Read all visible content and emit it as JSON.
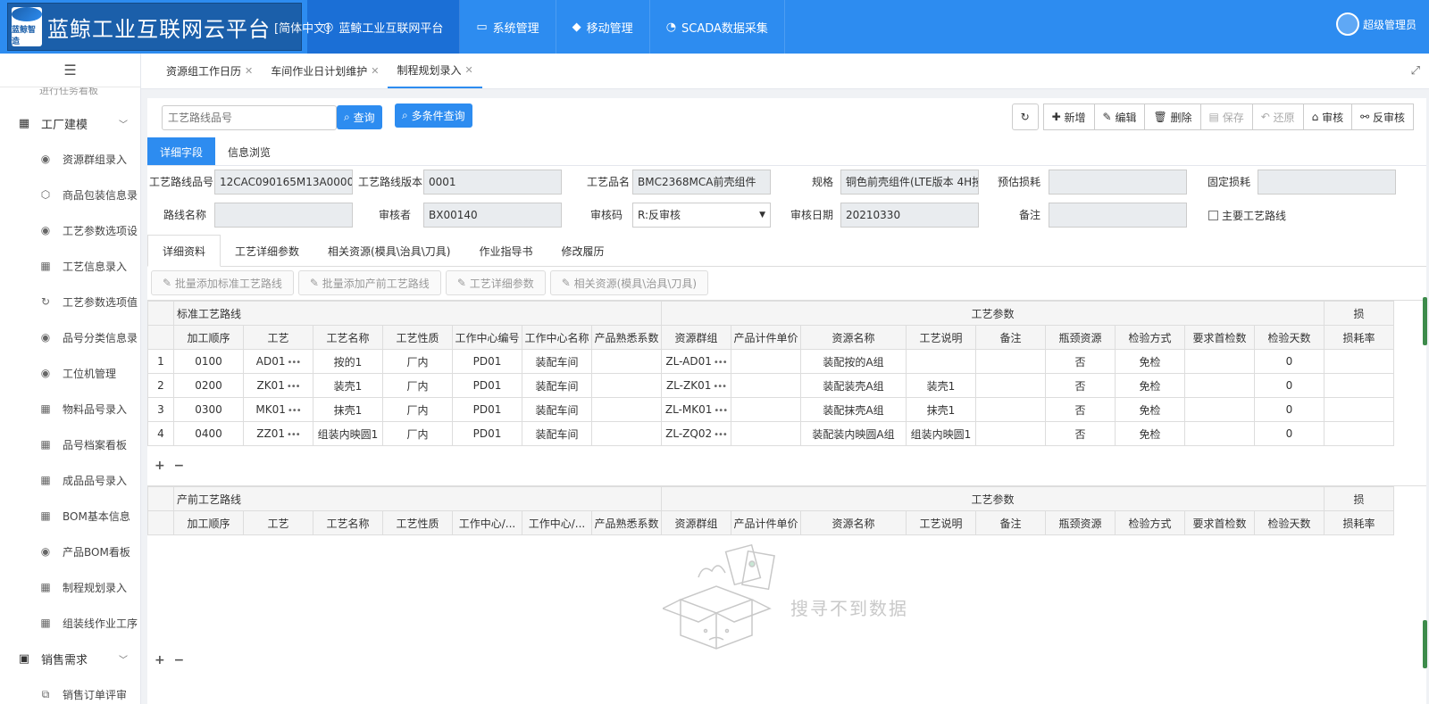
{
  "header": {
    "logo_text": "蓝鲸智造",
    "title": "蓝鲸工业互联网云平台",
    "lang": "[简体中文]",
    "nav": [
      {
        "label": "蓝鲸工业互联网平台",
        "icon": "circle-logo-icon"
      },
      {
        "label": "系统管理",
        "icon": "monitor-icon"
      },
      {
        "label": "移动管理",
        "icon": "android-icon"
      },
      {
        "label": "SCADA数据采集",
        "icon": "gauge-icon"
      }
    ],
    "user": "超级管理员"
  },
  "sidebar": {
    "cut_item": "进行任务看板",
    "group1": "工厂建模",
    "items": [
      {
        "label": "资源群组录入",
        "icon": "pin-icon"
      },
      {
        "label": "商品包装信息录",
        "icon": "package-icon"
      },
      {
        "label": "工艺参数选项设",
        "icon": "pin-icon"
      },
      {
        "label": "工艺信息录入",
        "icon": "grid-icon"
      },
      {
        "label": "工艺参数选项值",
        "icon": "refresh-icon"
      },
      {
        "label": "品号分类信息录",
        "icon": "pin-icon"
      },
      {
        "label": "工位机管理",
        "icon": "pin-icon"
      },
      {
        "label": "物料品号录入",
        "icon": "grid-icon"
      },
      {
        "label": "品号档案看板",
        "icon": "grid-icon"
      },
      {
        "label": "成品品号录入",
        "icon": "grid-icon"
      },
      {
        "label": "BOM基本信息",
        "icon": "grid-icon"
      },
      {
        "label": "产品BOM看板",
        "icon": "pin-icon"
      },
      {
        "label": "制程规划录入",
        "icon": "grid-icon"
      },
      {
        "label": "组装线作业工序",
        "icon": "grid-icon"
      }
    ],
    "group2": "销售需求",
    "item_last": "销售订单评审"
  },
  "tabs": [
    "资源组工作日历",
    "车间作业日计划维护",
    "制程规划录入"
  ],
  "toolbar": {
    "search_placeholder": "工艺路线品号",
    "query": "查询",
    "multi_query": "多条件查询",
    "add": "新增",
    "edit": "编辑",
    "delete": "删除",
    "save": "保存",
    "restore": "还原",
    "audit": "审核",
    "unaudit": "反审核"
  },
  "subtabs": [
    "详细字段",
    "信息浏览"
  ],
  "form": {
    "route_no_label": "工艺路线品号",
    "route_no": "12CAC090165M13A0000",
    "route_ver_label": "工艺路线版本",
    "route_ver": "0001",
    "product_name_label": "工艺品名",
    "product_name": "BMC2368MCA前壳组件",
    "spec_label": "规格",
    "spec": "铜色前壳组件(LTE版本 4H按",
    "est_loss_label": "预估损耗",
    "fixed_loss_label": "固定损耗",
    "route_name_label": "路线名称",
    "auditor_label": "审核者",
    "auditor": "BX00140",
    "audit_code_label": "审核码",
    "audit_code": "R:反审核",
    "audit_date_label": "审核日期",
    "audit_date": "20210330",
    "remark_label": "备注",
    "main_route_label": "主要工艺路线"
  },
  "detail_tabs": [
    "详细资料",
    "工艺详细参数",
    "相关资源(模具\\治具\\刀具)",
    "作业指导书",
    "修改履历"
  ],
  "actions": [
    "批量添加标准工艺路线",
    "批量添加产前工艺路线",
    "工艺详细参数",
    "相关资源(模具\\治具\\刀具)"
  ],
  "table1": {
    "group_left": "标准工艺路线",
    "group_right": "工艺参数",
    "group_far": "损",
    "columns": [
      "加工顺序",
      "工艺",
      "工艺名称",
      "工艺性质",
      "工作中心编号",
      "工作中心名称",
      "产品熟悉系数",
      "资源群组",
      "产品计件单价",
      "资源名称",
      "工艺说明",
      "备注",
      "瓶颈资源",
      "检验方式",
      "要求首检数",
      "检验天数",
      "损耗率"
    ],
    "rows": [
      [
        "1",
        "0100",
        "AD01",
        "按的1",
        "厂内",
        "PD01",
        "装配车间",
        "",
        "ZL-AD01",
        "",
        "装配按的A组",
        "",
        "",
        "否",
        "免检",
        "",
        "0",
        ""
      ],
      [
        "2",
        "0200",
        "ZK01",
        "装壳1",
        "厂内",
        "PD01",
        "装配车间",
        "",
        "ZL-ZK01",
        "",
        "装配装壳A组",
        "装壳1",
        "",
        "否",
        "免检",
        "",
        "0",
        ""
      ],
      [
        "3",
        "0300",
        "MK01",
        "抹壳1",
        "厂内",
        "PD01",
        "装配车间",
        "",
        "ZL-MK01",
        "",
        "装配抹壳A组",
        "抹壳1",
        "",
        "否",
        "免检",
        "",
        "0",
        ""
      ],
      [
        "4",
        "0400",
        "ZZ01",
        "组装内映圆1",
        "厂内",
        "PD01",
        "装配车间",
        "",
        "ZL-ZQ02",
        "",
        "装配装内映圆A组",
        "组装内映圆1",
        "",
        "否",
        "免检",
        "",
        "0",
        ""
      ]
    ]
  },
  "table2": {
    "group_left": "产前工艺路线",
    "group_right": "工艺参数",
    "group_far": "损",
    "columns": [
      "加工顺序",
      "工艺",
      "工艺名称",
      "工艺性质",
      "工作中心/...",
      "工作中心/...",
      "产品熟悉系数",
      "资源群组",
      "产品计件单价",
      "资源名称",
      "工艺说明",
      "备注",
      "瓶颈资源",
      "检验方式",
      "要求首检数",
      "检验天数",
      "损耗率"
    ],
    "empty_text": "搜寻不到数据"
  },
  "plusminus": {
    "plus": "+",
    "minus": "−"
  }
}
